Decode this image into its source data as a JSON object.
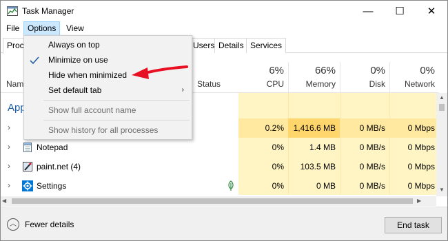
{
  "window": {
    "title": "Task Manager",
    "controls": {
      "minimize": "—",
      "maximize": "☐",
      "close": "✕"
    }
  },
  "menubar": {
    "file": "File",
    "options": "Options",
    "view": "View"
  },
  "tabs": [
    {
      "label": "Proc"
    },
    {
      "label": "Users"
    },
    {
      "label": "Details"
    },
    {
      "label": "Services"
    }
  ],
  "header": {
    "name": "Nam",
    "status": "Status",
    "cpu": {
      "pct": "6%",
      "label": "CPU"
    },
    "memory": {
      "pct": "66%",
      "label": "Memory"
    },
    "disk": {
      "pct": "0%",
      "label": "Disk"
    },
    "network": {
      "pct": "0%",
      "label": "Network"
    }
  },
  "section_title": "App",
  "rows": [
    {
      "name": "",
      "cpu": "0.2%",
      "memory": "1,416.6 MB",
      "disk": "0 MB/s",
      "network": "0 Mbps"
    },
    {
      "name": "Notepad",
      "cpu": "0%",
      "memory": "1.4 MB",
      "disk": "0 MB/s",
      "network": "0 Mbps"
    },
    {
      "name": "paint.net (4)",
      "cpu": "0%",
      "memory": "103.5 MB",
      "disk": "0 MB/s",
      "network": "0 Mbps"
    },
    {
      "name": "Settings",
      "cpu": "0%",
      "memory": "0 MB",
      "disk": "0 MB/s",
      "network": "0 Mbps"
    }
  ],
  "options_menu": {
    "items": [
      {
        "label": "Always on top"
      },
      {
        "label": "Minimize on use",
        "checked": true
      },
      {
        "label": "Hide when minimized"
      },
      {
        "label": "Set default tab",
        "submenu": true
      },
      {
        "label": "Show full account name",
        "disabled": true
      },
      {
        "label": "Show history for all processes",
        "disabled": true
      }
    ]
  },
  "footer": {
    "fewer_details": "Fewer details",
    "end_task": "End task"
  },
  "colors": {
    "accent": "#0078d7",
    "heat_mid": "#ffd66b",
    "heat_low": "#fff4c4",
    "arrow": "#e81123",
    "section": "#1c5fa8"
  }
}
